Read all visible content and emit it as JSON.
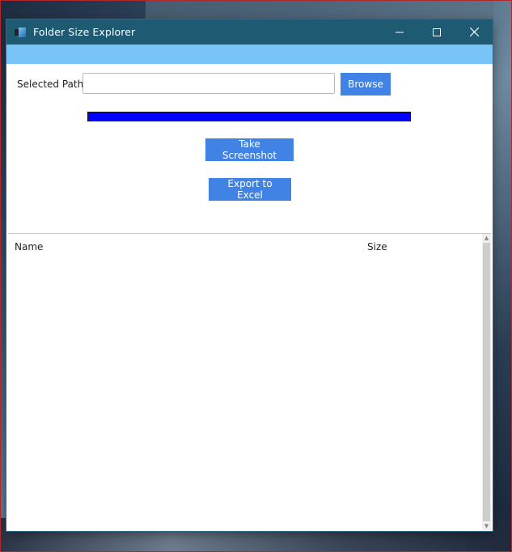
{
  "window": {
    "title": "Folder Size Explorer",
    "controls": {
      "minimize": "minimize-icon",
      "maximize": "maximize-icon",
      "close": "close-icon"
    }
  },
  "path": {
    "label": "Selected Path:",
    "value": "",
    "placeholder": "",
    "browse_label": "Browse"
  },
  "progress": {
    "percent": 100,
    "color": "#0000ff"
  },
  "actions": {
    "screenshot_label": "Take Screenshot",
    "export_label": "Export to Excel"
  },
  "table": {
    "columns": [
      "Name",
      "Size"
    ],
    "rows": []
  },
  "colors": {
    "titlebar": "#1f5a73",
    "menubar": "#79c4f7",
    "button": "#4083e4"
  }
}
